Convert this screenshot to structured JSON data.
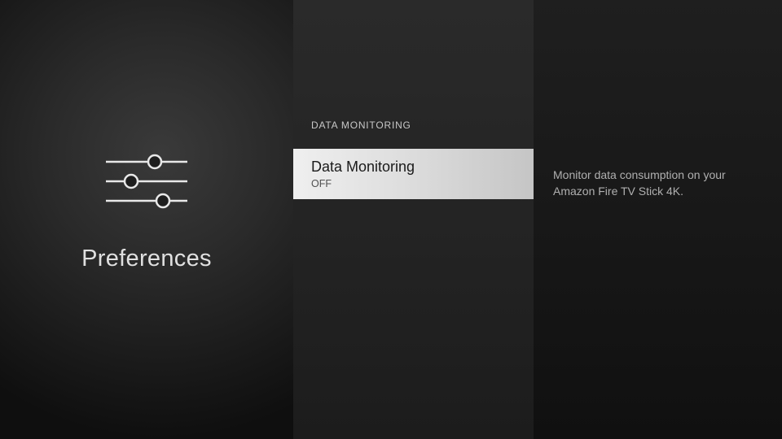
{
  "left": {
    "title": "Preferences"
  },
  "middle": {
    "section_header": "DATA MONITORING",
    "option": {
      "title": "Data Monitoring",
      "value": "OFF"
    }
  },
  "right": {
    "description": "Monitor data consumption on your Amazon Fire TV Stick 4K."
  }
}
